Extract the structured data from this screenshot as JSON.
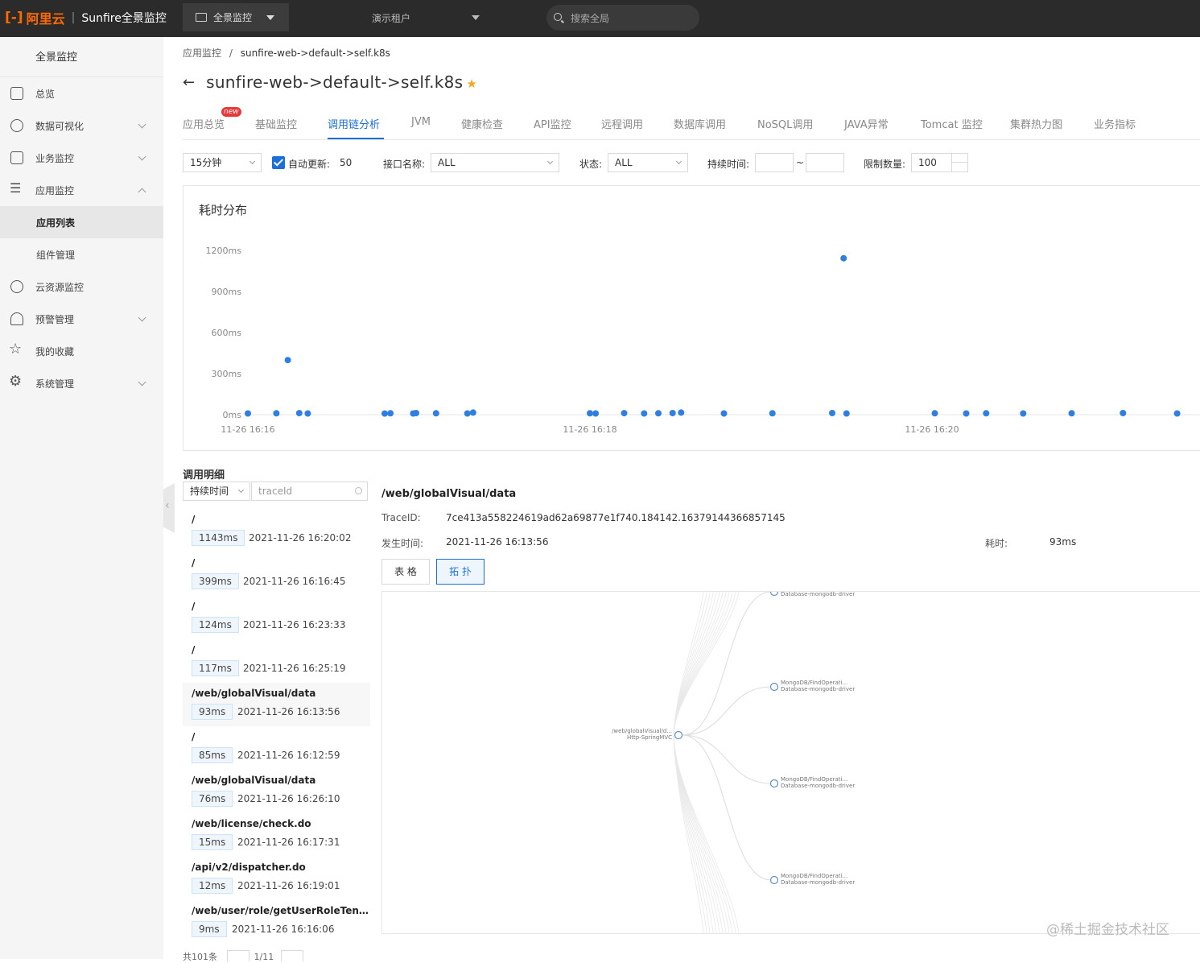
{
  "topbar": {
    "logo_mark": "[-]",
    "logo_text": "阿里云",
    "product": "Sunfire全景监控",
    "module": "全景监控",
    "tenant": "演示租户",
    "search_placeholder": "搜索全局"
  },
  "sidebar": {
    "title": "全景监控",
    "items": [
      {
        "label": "总览",
        "icon": "home-icon"
      },
      {
        "label": "数据可视化",
        "icon": "dashboard-icon"
      },
      {
        "label": "业务监控",
        "icon": "monitor-icon"
      },
      {
        "label": "应用监控",
        "icon": "list-icon"
      },
      {
        "label": "应用列表"
      },
      {
        "label": "组件管理"
      },
      {
        "label": "云资源监控",
        "icon": "cloud-icon"
      },
      {
        "label": "预警管理",
        "icon": "bell-icon"
      },
      {
        "label": "我的收藏",
        "icon": "star-icon"
      },
      {
        "label": "系统管理",
        "icon": "gear-icon"
      }
    ]
  },
  "breadcrumb": {
    "root": "应用监控",
    "sep": "/",
    "current": "sunfire-web->default->self.k8s"
  },
  "page": {
    "title": "sunfire-web->default->self.k8s"
  },
  "tabs": [
    {
      "label": "应用总览"
    },
    {
      "label": "基础监控"
    },
    {
      "label": "调用链分析"
    },
    {
      "label": "JVM"
    },
    {
      "label": "健康检查"
    },
    {
      "label": "API监控"
    },
    {
      "label": "远程调用"
    },
    {
      "label": "数据库调用"
    },
    {
      "label": "NoSQL调用"
    },
    {
      "label": "JAVA异常"
    },
    {
      "label": "Tomcat 监控"
    },
    {
      "label": "集群热力图"
    },
    {
      "label": "业务指标"
    }
  ],
  "new_badge": "new",
  "filters": {
    "range": "15分钟",
    "auto_refresh_label": "自动更新:",
    "auto_refresh_value": "50",
    "api_label": "接口名称:",
    "api_value": "ALL",
    "status_label": "状态:",
    "status_value": "ALL",
    "duration_label": "持续时间:",
    "duration_sep": "~",
    "limit_label": "限制数量:",
    "limit_value": "100"
  },
  "chart_title": "耗时分布",
  "chart_data": {
    "type": "scatter",
    "title": "耗时分布",
    "y_ticks": [
      "1200ms",
      "900ms",
      "600ms",
      "300ms",
      "0ms"
    ],
    "x_ticks": [
      "11-26 16:16",
      "11-26 16:18",
      "11-26 16:20"
    ],
    "ylim": [
      0,
      1200
    ],
    "points": [
      {
        "x": "16:16:00",
        "y": 9
      },
      {
        "x": "16:16:10",
        "y": 10
      },
      {
        "x": "16:16:14",
        "y": 399
      },
      {
        "x": "16:16:18",
        "y": 11
      },
      {
        "x": "16:16:21",
        "y": 9
      },
      {
        "x": "16:16:48",
        "y": 8
      },
      {
        "x": "16:16:50",
        "y": 10
      },
      {
        "x": "16:16:58",
        "y": 9
      },
      {
        "x": "16:16:59",
        "y": 12
      },
      {
        "x": "16:17:06",
        "y": 10
      },
      {
        "x": "16:17:17",
        "y": 9
      },
      {
        "x": "16:17:19",
        "y": 15
      },
      {
        "x": "16:18:00",
        "y": 10
      },
      {
        "x": "16:18:02",
        "y": 9
      },
      {
        "x": "16:18:12",
        "y": 11
      },
      {
        "x": "16:18:19",
        "y": 9
      },
      {
        "x": "16:18:24",
        "y": 10
      },
      {
        "x": "16:18:29",
        "y": 12
      },
      {
        "x": "16:18:32",
        "y": 15
      },
      {
        "x": "16:18:47",
        "y": 9
      },
      {
        "x": "16:19:04",
        "y": 10
      },
      {
        "x": "16:19:25",
        "y": 12
      },
      {
        "x": "16:19:29",
        "y": 1143
      },
      {
        "x": "16:19:30",
        "y": 9
      },
      {
        "x": "16:20:01",
        "y": 10
      },
      {
        "x": "16:20:12",
        "y": 9
      },
      {
        "x": "16:20:19",
        "y": 10
      },
      {
        "x": "16:20:32",
        "y": 9
      },
      {
        "x": "16:20:49",
        "y": 10
      },
      {
        "x": "16:21:07",
        "y": 12
      },
      {
        "x": "16:21:26",
        "y": 9
      }
    ]
  },
  "detail": {
    "title": "调用明细",
    "sort_select": "持续时间",
    "search_placeholder": "traceId",
    "items": [
      {
        "path": "/",
        "ms": "1143ms",
        "time": "2021-11-26 16:20:02"
      },
      {
        "path": "/",
        "ms": "399ms",
        "time": "2021-11-26 16:16:45"
      },
      {
        "path": "/",
        "ms": "124ms",
        "time": "2021-11-26 16:23:33"
      },
      {
        "path": "/",
        "ms": "117ms",
        "time": "2021-11-26 16:25:19"
      },
      {
        "path": "/web/globalVisual/data",
        "ms": "93ms",
        "time": "2021-11-26 16:13:56"
      },
      {
        "path": "/",
        "ms": "85ms",
        "time": "2021-11-26 16:12:59"
      },
      {
        "path": "/web/globalVisual/data",
        "ms": "76ms",
        "time": "2021-11-26 16:26:10"
      },
      {
        "path": "/web/license/check.do",
        "ms": "15ms",
        "time": "2021-11-26 16:17:31"
      },
      {
        "path": "/api/v2/dispatcher.do",
        "ms": "12ms",
        "time": "2021-11-26 16:19:01"
      },
      {
        "path": "/web/user/role/getUserRoleTenan...",
        "ms": "9ms",
        "time": "2021-11-26 16:16:06"
      }
    ],
    "pager_total": "共101条",
    "pager_page": "1/11"
  },
  "trace": {
    "path": "/web/globalVisual/data",
    "traceid_label": "TraceID:",
    "traceid_value": "7ce413a558224619ad62a69877e1f740.184142.16379144366857145",
    "time_label": "发生时间:",
    "time_value": "2021-11-26 16:13:56",
    "cost_label": "耗时:",
    "cost_value": "93ms",
    "btn_table": "表 格",
    "btn_topo": "拓 扑",
    "root_node": [
      "/web/globalVisual/d...",
      "Http-SpringMVC"
    ],
    "child_nodes": [
      [
        "",
        "Database-mongodb-driver"
      ],
      [
        "MongoDB/FindOperati...",
        "Database-mongodb-driver"
      ],
      [
        "MongoDB/FindOperati...",
        "Database-mongodb-driver"
      ],
      [
        "MongoDB/FindOperati...",
        "Database-mongodb-driver"
      ]
    ]
  },
  "watermark": "@稀土掘金技术社区"
}
